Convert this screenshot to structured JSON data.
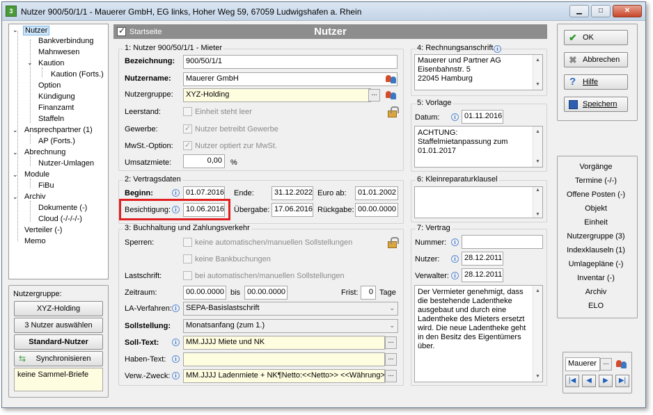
{
  "window": {
    "title": "Nutzer 900/50/1/1 - Mauerer GmbH, EG links, Hoher Weg 59, 67059 Ludwigshafen a. Rhein",
    "app_icon": "3"
  },
  "tree": {
    "items": [
      "Nutzer",
      "Bankverbindung",
      "Mahnwesen",
      "Kaution",
      "Kaution (Forts.)",
      "Option",
      "Kündigung",
      "Finanzamt",
      "Staffeln",
      "Ansprechpartner (1)",
      "AP (Forts.)",
      "Abrechnung",
      "Nutzer-Umlagen",
      "Module",
      "FiBu",
      "Archiv",
      "Dokumente (-)",
      "Cloud (-/-/-/-)",
      "Verteiler (-)",
      "Memo"
    ]
  },
  "left_bottom": {
    "label": "Nutzergruppe:",
    "group_button": "XYZ-Holding",
    "select_users": "3 Nutzer auswählen",
    "standard_user": "Standard-Nutzer",
    "sync": "Synchronisieren",
    "memo": "keine Sammel-Briefe"
  },
  "header": {
    "startseite": "Startseite",
    "title": "Nutzer"
  },
  "section1": {
    "title": "1: Nutzer 900/50/1/1 - Mieter",
    "bezeichnung_label": "Bezeichnung:",
    "bezeichnung": "900/50/1/1",
    "nutzername_label": "Nutzername:",
    "nutzername": "Mauerer GmbH",
    "nutzergruppe_label": "Nutzergruppe:",
    "nutzergruppe": "XYZ-Holding",
    "dots": "...",
    "leerstand_label": "Leerstand:",
    "leerstand_text": "Einheit steht leer",
    "gewerbe_label": "Gewerbe:",
    "gewerbe_text": "Nutzer betreibt Gewerbe",
    "mwst_label": "MwSt.-Option:",
    "mwst_text": "Nutzer optiert zur MwSt.",
    "umsatzmiete_label": "Umsatzmiete:",
    "umsatzmiete": "0,00",
    "umsatzmiete_unit": "%"
  },
  "section2": {
    "title": "2: Vertragsdaten",
    "beginn_label": "Beginn:",
    "beginn": "01.07.2016",
    "ende_label": "Ende:",
    "ende": "31.12.2022",
    "euro_ab_label": "Euro ab:",
    "euro_ab": "01.01.2002",
    "besichtigung_label": "Besichtigung:",
    "besichtigung": "10.06.2016",
    "uebergabe_label": "Übergabe:",
    "uebergabe": "17.06.2016",
    "rueckgabe_label": "Rückgabe:",
    "rueckgabe": "00.00.0000",
    "highlight_color": "#e02020"
  },
  "section3": {
    "title": "3: Buchhaltung und Zahlungsverkehr",
    "sperren_label": "Sperren:",
    "sperre1": "keine automatischen/manuellen Sollstellungen",
    "sperre2": "keine Bankbuchungen",
    "lastschrift_label": "Lastschrift:",
    "lastschrift_text": "bei automatischen/manuellen Sollstellungen",
    "zeitraum_label": "Zeitraum:",
    "zeitraum_von": "00.00.0000",
    "bis_label": "bis",
    "zeitraum_bis": "00.00.0000",
    "frist_label": "Frist:",
    "frist": "0",
    "tage_label": "Tage",
    "la_label": "LA-Verfahren:",
    "la_value": "SEPA-Basislastschrift",
    "sollstellung_label": "Sollstellung:",
    "sollstellung_value": "Monatsanfang (zum 1.)",
    "solltext_label": "Soll-Text:",
    "solltext": "MM.JJJJ Miete und NK",
    "habentext_label": "Haben-Text:",
    "habentext": "",
    "zweck_label": "Verw.-Zweck:",
    "zweck": "MM.JJJJ Ladenmiete + NK¶Netto:<<Netto>> <<Währung>>"
  },
  "section4": {
    "title": "4: Rechnungsanschrift",
    "lines": [
      "Mauerer und Partner AG",
      "Eisenbahnstr. 5",
      "22045 Hamburg"
    ]
  },
  "section5": {
    "title": "5: Vorlage",
    "datum_label": "Datum:",
    "datum": "01.11.2016",
    "text_lines": [
      "ACHTUNG:",
      "Staffelmietanpassung zum",
      "01.01.2017"
    ]
  },
  "section6": {
    "title": "6: Kleinreparaturklausel"
  },
  "section7": {
    "title": "7: Vertrag",
    "nummer_label": "Nummer:",
    "nummer": "",
    "nutzer_label": "Nutzer:",
    "nutzer": "28.12.2011",
    "verwalter_label": "Verwalter:",
    "verwalter": "28.12.2011",
    "text_lines": [
      "Der Vermieter genehmigt, dass",
      "die bestehende Ladentheke",
      "ausgebaut und durch eine",
      "Ladentheke des Mieters ersetzt",
      "wird. Die neue Ladentheke geht",
      "in den Besitz des Eigentümers",
      "über."
    ]
  },
  "actions": {
    "ok": "OK",
    "cancel": "Abbrechen",
    "help": "Hilfe",
    "save": "Speichern"
  },
  "links": [
    "Vorgänge",
    "Termine (-/-)",
    "Offene Posten (-)",
    "Objekt",
    "Einheit",
    "Nutzergruppe (3)",
    "Indexklauseln (1)",
    "Umlagepläne (-)",
    "Inventar (-)",
    "Archiv",
    "ELO"
  ],
  "search": {
    "value": "Mauerer",
    "dots": "..."
  },
  "nav": [
    "first",
    "prev",
    "next",
    "last"
  ]
}
